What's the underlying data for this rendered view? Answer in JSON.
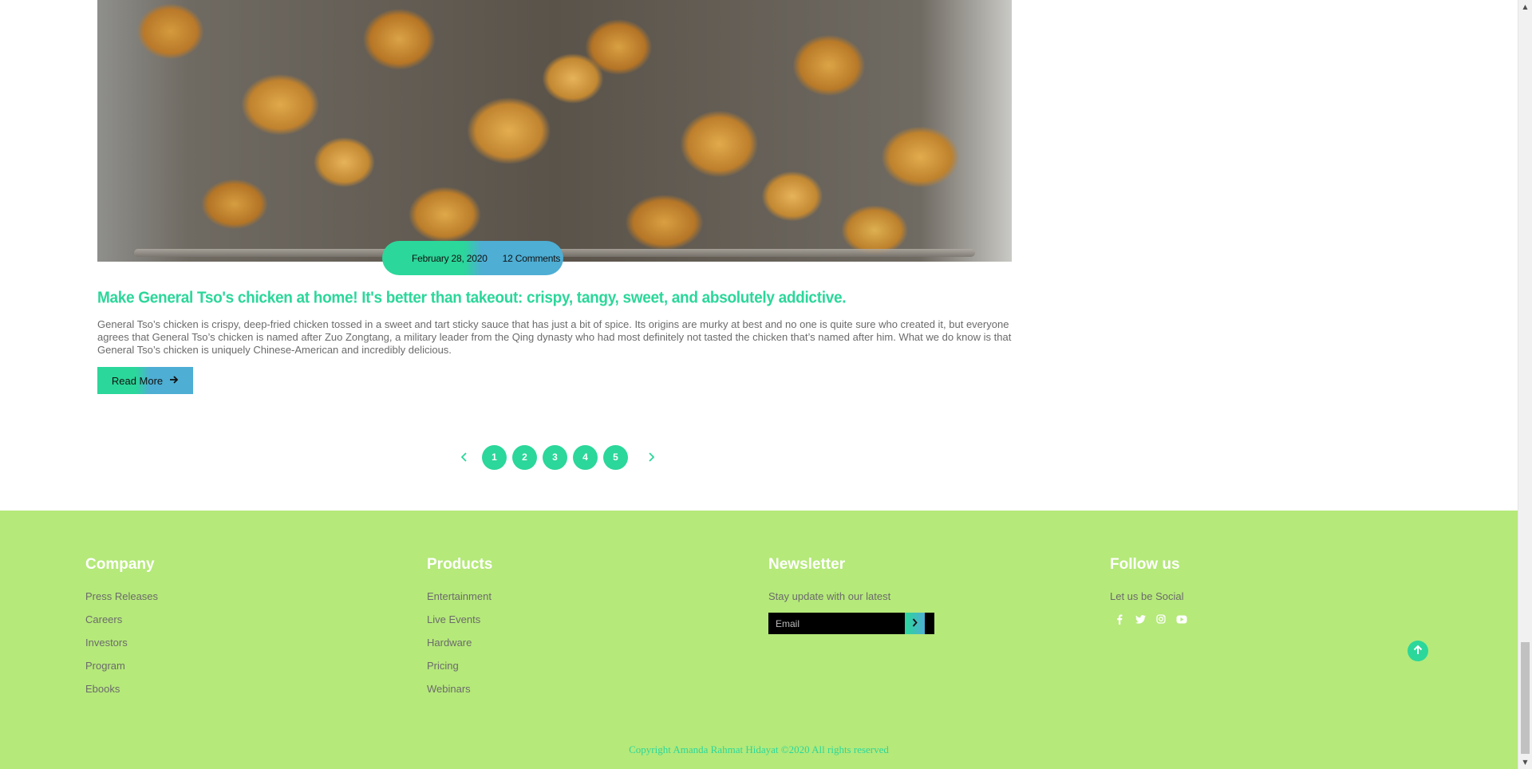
{
  "post": {
    "image_alt": "General Tso's chicken",
    "date": "February 28, 2020",
    "comments": "12 Comments",
    "title": "Make General Tso's chicken at home! It's better than takeout: crispy, tangy, sweet, and absolutely addictive.",
    "excerpt": "General Tso’s chicken is crispy, deep-fried chicken tossed in a sweet and tart sticky sauce that has just a bit of spice. Its origins are murky at best and no one is quite sure who created it, but everyone agrees that General Tso’s chicken is named after Zuo Zongtang, a military leader from the Qing dynasty who had most definitely not tasted the chicken that’s named after him. What we do know is that General Tso’s chicken is uniquely Chinese-American and incredibly delicious.",
    "read_more_label": "Read More",
    "read_more_icon": "arrow-right-icon"
  },
  "pagination": {
    "prev_icon": "chevron-left-icon",
    "next_icon": "chevron-right-icon",
    "pages": [
      "1",
      "2",
      "3",
      "4",
      "5"
    ]
  },
  "footer": {
    "company": {
      "title": "Company",
      "links": [
        "Press Releases",
        "Careers",
        "Investors",
        "Program",
        "Ebooks"
      ]
    },
    "products": {
      "title": "Products",
      "links": [
        "Entertainment",
        "Live Events",
        "Hardware",
        "Pricing",
        "Webinars"
      ]
    },
    "newsletter": {
      "title": "Newsletter",
      "text": "Stay update with our latest",
      "email_placeholder": "Email",
      "submit_icon": "chevron-right-icon"
    },
    "follow": {
      "title": "Follow us",
      "text": "Let us be Social",
      "icons": [
        "facebook-icon",
        "twitter-icon",
        "instagram-icon",
        "youtube-icon"
      ]
    },
    "back_to_top_icon": "arrow-up-circle-icon",
    "copyright": "Copyright Amanda Rahmat Hidayat ©2020 All rights reserved"
  },
  "colors": {
    "accent_green": "#2bd79a",
    "accent_blue": "#4eaed4",
    "footer_bg": "#b5e97a",
    "body_text": "#6b6b6b"
  }
}
